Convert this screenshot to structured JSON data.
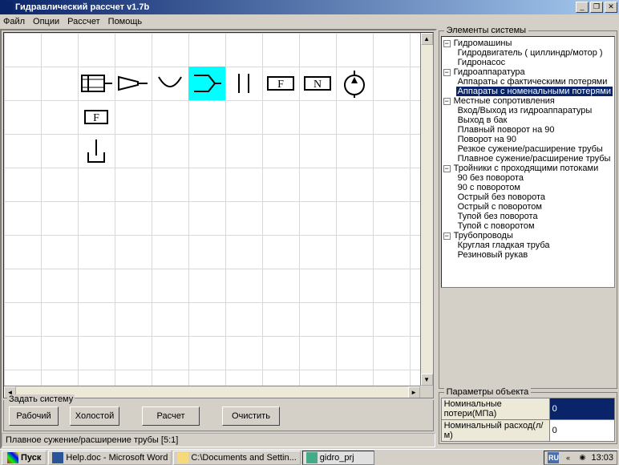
{
  "window": {
    "title": "Гидравлический рассчет v1.7b"
  },
  "menu": {
    "file": "Файл",
    "options": "Опции",
    "calc": "Рассчет",
    "help": "Помощь"
  },
  "system_group": {
    "label": "Задать систему",
    "work": "Рабочий",
    "idle": "Холостой",
    "calc": "Расчет",
    "clear": "Очистить"
  },
  "status": "Плавное сужение/расширение трубы [5:1]",
  "tree": {
    "title": "Элементы системы",
    "nodes": [
      {
        "label": "Гидромашины",
        "children": [
          {
            "label": "Гидродвигатель ( циллиндр/мотор )"
          },
          {
            "label": "Гидронасос"
          }
        ]
      },
      {
        "label": "Гидроаппаратура",
        "children": [
          {
            "label": "Аппараты с фактическими потерями"
          },
          {
            "label": "Аппараты с номенальными потерями",
            "selected": true
          }
        ]
      },
      {
        "label": "Местные сопротивления",
        "children": [
          {
            "label": "Вход/Выход из гидроаппаратуры"
          },
          {
            "label": "Выход в бак"
          },
          {
            "label": "Плавный поворот на 90"
          },
          {
            "label": "Поворот на 90"
          },
          {
            "label": "Резкое сужение/расширение трубы"
          },
          {
            "label": "Плавное сужение/расширение трубы"
          }
        ]
      },
      {
        "label": "Тройники с проходящими потоками",
        "children": [
          {
            "label": "90 без поворота"
          },
          {
            "label": "90 с поворотом"
          },
          {
            "label": "Острый без поворота"
          },
          {
            "label": "Острый с поворотом"
          },
          {
            "label": "Тупой без поворота"
          },
          {
            "label": "Тупой с поворотом"
          }
        ]
      },
      {
        "label": "Трубопроводы",
        "children": [
          {
            "label": "Круглая гладкая труба"
          },
          {
            "label": "Резиновый рукав"
          }
        ]
      }
    ]
  },
  "params": {
    "title": "Параметры объекта",
    "rows": [
      {
        "name": "Номинальные потери(МПа)",
        "value": "0"
      },
      {
        "name": "Номинальный расход(л/м)",
        "value": "0"
      }
    ]
  },
  "taskbar": {
    "start": "Пуск",
    "items": [
      {
        "label": "Help.doc - Microsoft Word",
        "icon": "word"
      },
      {
        "label": "C:\\Documents and Settin...",
        "icon": "folder"
      },
      {
        "label": "gidro_prj",
        "icon": "app",
        "active": true
      }
    ],
    "lang": "RU",
    "time": "13:03"
  }
}
